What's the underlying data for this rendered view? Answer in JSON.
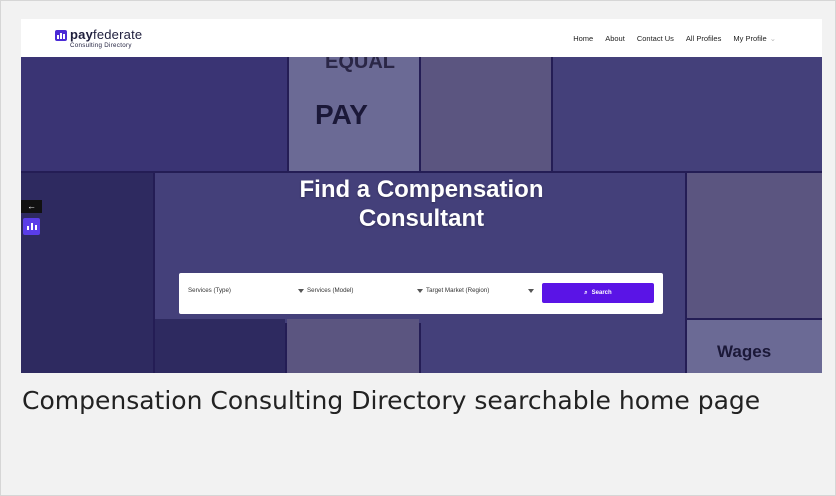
{
  "site": {
    "brand_bold": "pay",
    "brand_rest": "federate",
    "brand_sub": "Consulting Directory"
  },
  "nav": {
    "items": [
      "Home",
      "About",
      "Contact Us",
      "All Profiles",
      "My Profile"
    ]
  },
  "hero": {
    "title_line1": "Find a Compensation",
    "title_line2": "Consultant",
    "image_texts": {
      "equal": "EQUAL",
      "pay": "PAY",
      "wages": "Wages"
    }
  },
  "search": {
    "field1": "Services (Type)",
    "field2": "Services (Model)",
    "field3": "Target Market (Region)",
    "button": "Search"
  },
  "side": {
    "back_glyph": "←"
  },
  "caption": "Compensation Consulting Directory searchable home page",
  "colors": {
    "accent": "#5a14e6",
    "overlay": "#241d55"
  }
}
